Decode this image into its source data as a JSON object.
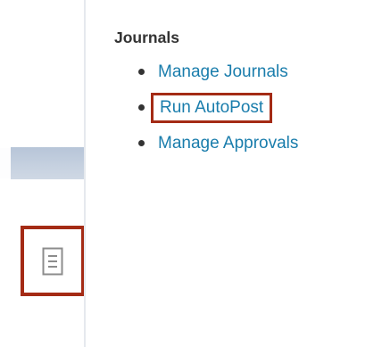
{
  "journals_panel": {
    "title": "Journals",
    "items": [
      {
        "label": "Manage Journals"
      },
      {
        "label": "Run AutoPost"
      },
      {
        "label": "Manage Approvals"
      }
    ]
  },
  "left_rail": {
    "task_icon": "document-list-icon"
  },
  "colors": {
    "link": "#1a7dac",
    "highlight_border": "#a42b15",
    "title_text": "#333333"
  }
}
